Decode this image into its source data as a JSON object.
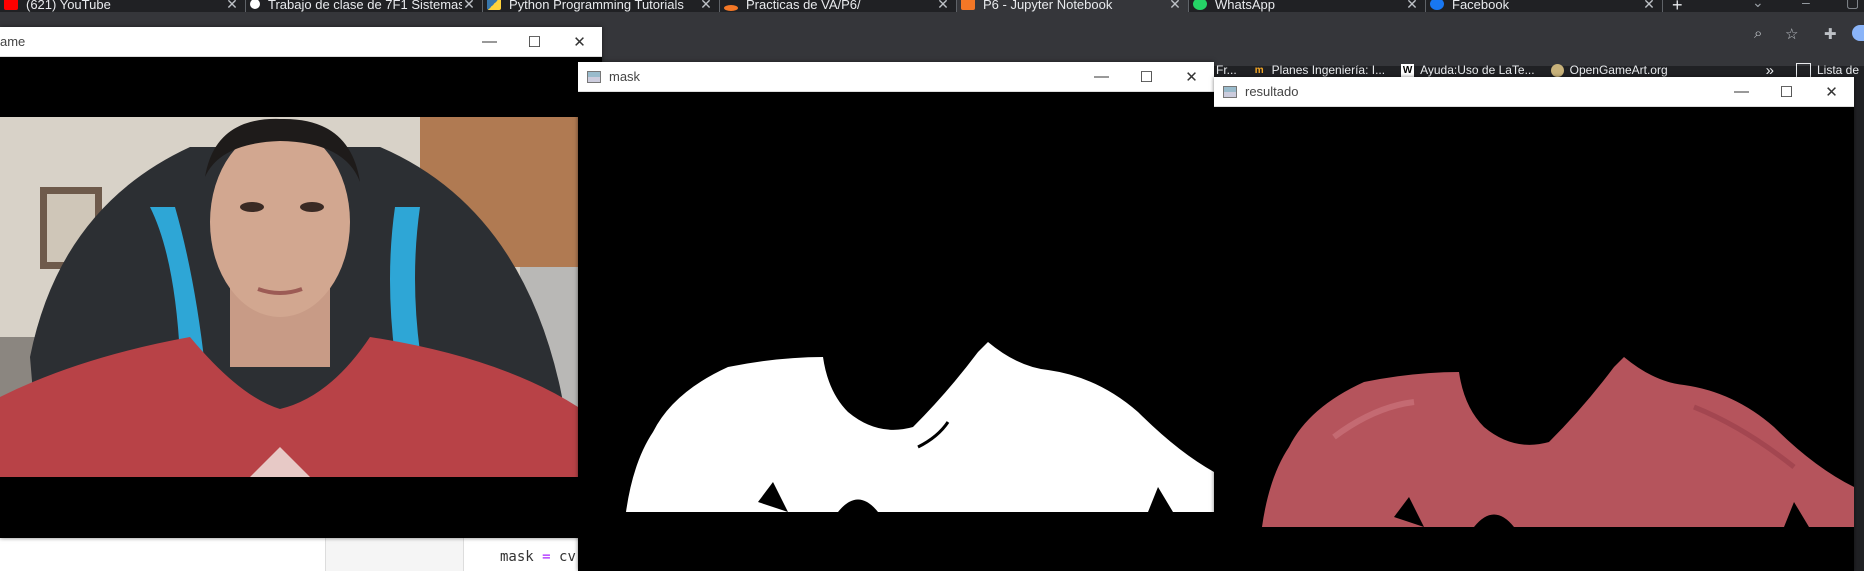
{
  "browser": {
    "tabs": [
      {
        "title": "(621) YouTube",
        "favicon_color": "#ff0000",
        "active": false
      },
      {
        "title": "Trabajo de clase de 7F1 Sistemas",
        "favicon_color": "#ffffff",
        "active": false
      },
      {
        "title": "Python Programming Tutorials",
        "favicon_color": "#3776ab",
        "active": false
      },
      {
        "title": "Practicas de VA/P6/",
        "favicon_color": "#f37726",
        "active": false
      },
      {
        "title": "P6 - Jupyter Notebook",
        "favicon_color": "#f37726",
        "active": true
      },
      {
        "title": "WhatsApp",
        "favicon_color": "#25d366",
        "active": false
      },
      {
        "title": "Facebook",
        "favicon_color": "#1877f2",
        "active": false
      }
    ],
    "bookmarks": [
      {
        "label": "Fr...",
        "icon": "bookmark-icon"
      },
      {
        "label": "Planes Ingeniería: I...",
        "icon": "io-icon"
      },
      {
        "label": "Ayuda:Uso de LaTe...",
        "icon": "wikipedia-icon"
      },
      {
        "label": "OpenGameArt.org",
        "icon": "opengameart-icon"
      }
    ],
    "bookmarks_overflow": "»",
    "reading_list": "Lista de"
  },
  "editor": {
    "code_var": "mask",
    "code_op": "=",
    "code_rest": "cv"
  },
  "windows": {
    "frame": {
      "title": "ame"
    },
    "mask": {
      "title": "mask"
    },
    "resultado": {
      "title": "resultado"
    }
  },
  "colors": {
    "shirt_red": "#b84247",
    "result_red": "#b5545c",
    "wall": "#d9d4cc",
    "chair_blue": "#2ea6d6"
  }
}
